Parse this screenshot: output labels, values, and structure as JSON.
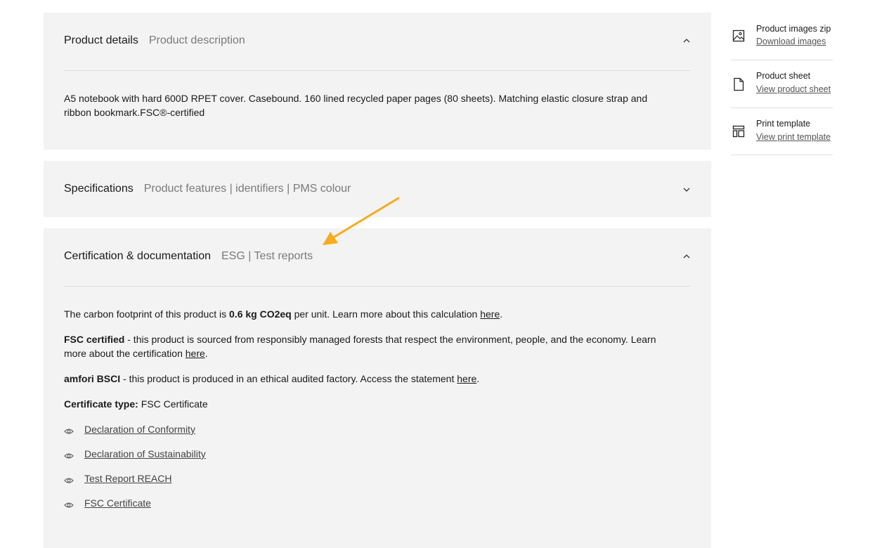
{
  "details": {
    "title": "Product details",
    "subtitle": "Product description",
    "description": "A5 notebook with hard 600D RPET cover. Casebound. 160 lined recycled paper pages (80 sheets). Matching elastic closure strap and ribbon bookmark.FSC®-certified"
  },
  "specifications": {
    "title": "Specifications",
    "subtitle": "Product features | identifiers | PMS colour"
  },
  "certification": {
    "title": "Certification & documentation",
    "subtitle": "ESG | Test reports",
    "carbon": {
      "pre": "The carbon footprint of this product is ",
      "value": "0.6 kg CO2eq",
      "post": " per unit. Learn more about this calculation ",
      "link": "here",
      "end": "."
    },
    "fsc": {
      "bold": "FSC certified",
      "text": " - this product is sourced from responsibly managed forests that respect the environment, people, and the economy. Learn more about the certification ",
      "link": "here",
      "end": "."
    },
    "bsci": {
      "bold": "amfori BSCI",
      "text": " - this product is produced in an ethical audited factory. Access the statement ",
      "link": "here",
      "end": "."
    },
    "certificate_type": {
      "label": "Certificate type:",
      "value": " FSC Certificate"
    },
    "documents": [
      {
        "label": "Declaration of Conformity",
        "icon": "eye-icon"
      },
      {
        "label": "Declaration of Sustainability",
        "icon": "eye-icon"
      },
      {
        "label": "Test Report REACH",
        "icon": "eye-icon"
      },
      {
        "label": "FSC Certificate",
        "icon": "eye-icon"
      }
    ]
  },
  "sidebar": {
    "items": [
      {
        "title": "Product images zip",
        "link": "Download images",
        "icon": "image-icon"
      },
      {
        "title": "Product sheet",
        "link": "View product sheet",
        "icon": "file-icon"
      },
      {
        "title": "Print template",
        "link": "View print template",
        "icon": "layout-template-icon"
      }
    ]
  },
  "colors": {
    "panel_bg": "#f3f3f3",
    "divider": "#dedede",
    "subtitle_text": "#7a7a7a",
    "annotation_arrow": "#f5ac1e"
  }
}
